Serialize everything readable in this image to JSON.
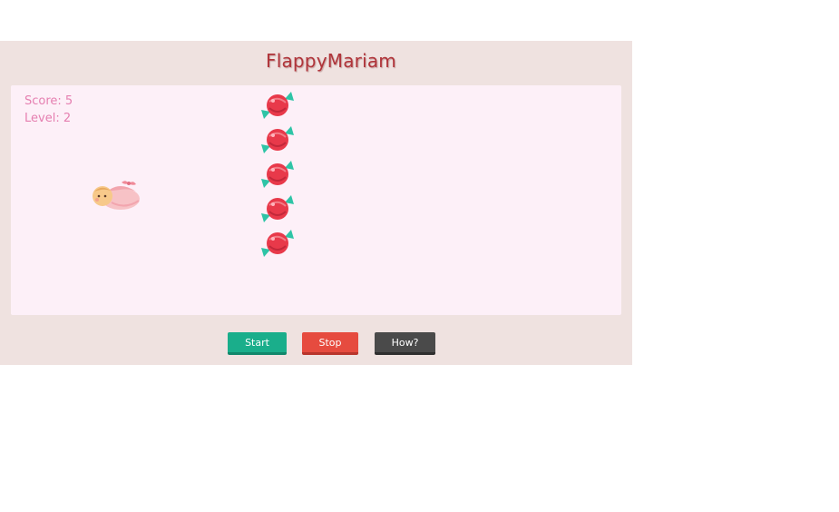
{
  "game": {
    "title": "FlappyMariam",
    "score_text": "Score: 5",
    "level_text": "Level: 2"
  },
  "controls": {
    "start_label": "Start",
    "stop_label": "Stop",
    "how_label": "How?"
  },
  "sprites": {
    "player_icon": "baby-in-blanket-icon",
    "obstacle_icon": "wrapped-candy-icon",
    "obstacle_count": 5
  },
  "colors": {
    "title": "#b0343a",
    "hud_text": "#e57fb0",
    "board_bg": "#fdf0f8",
    "frame_bg": "#efe2e0",
    "start_button": "#1aae8b",
    "stop_button": "#e64b3f",
    "how_button": "#4a4a4a",
    "candy": "#e8394a",
    "candy_wrapper": "#2ec4a6"
  }
}
